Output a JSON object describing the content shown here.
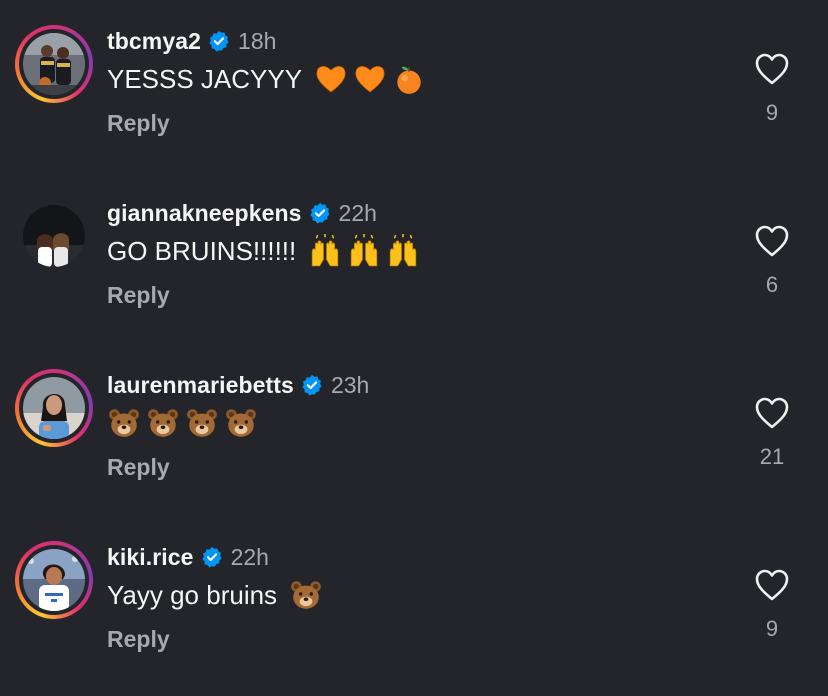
{
  "comments": [
    {
      "username": "tbcmya2",
      "time": "18h",
      "text": "YESSS JACYYY",
      "emojis": [
        "orange-heart-icon",
        "orange-heart-icon",
        "tangerine-icon"
      ],
      "reply_label": "Reply",
      "likes": "9",
      "story_ring": true
    },
    {
      "username": "giannakneepkens",
      "time": "22h",
      "text": "GO BRUINS!!!!!!",
      "emojis": [
        "raising-hands-icon",
        "raising-hands-icon",
        "raising-hands-icon"
      ],
      "reply_label": "Reply",
      "likes": "6",
      "story_ring": false
    },
    {
      "username": "laurenmariebetts",
      "time": "23h",
      "text": "",
      "emojis": [
        "bear-face-icon",
        "bear-face-icon",
        "bear-face-icon",
        "bear-face-icon"
      ],
      "reply_label": "Reply",
      "likes": "21",
      "story_ring": true
    },
    {
      "username": "kiki.rice",
      "time": "22h",
      "text": "Yayy go bruins",
      "emojis": [
        "bear-face-icon"
      ],
      "reply_label": "Reply",
      "likes": "9",
      "story_ring": true
    }
  ],
  "colors": {
    "background": "#24252a",
    "primary_text": "#f5f5f5",
    "secondary_text": "#a8a8ad",
    "verified_blue": "#0095f6"
  }
}
